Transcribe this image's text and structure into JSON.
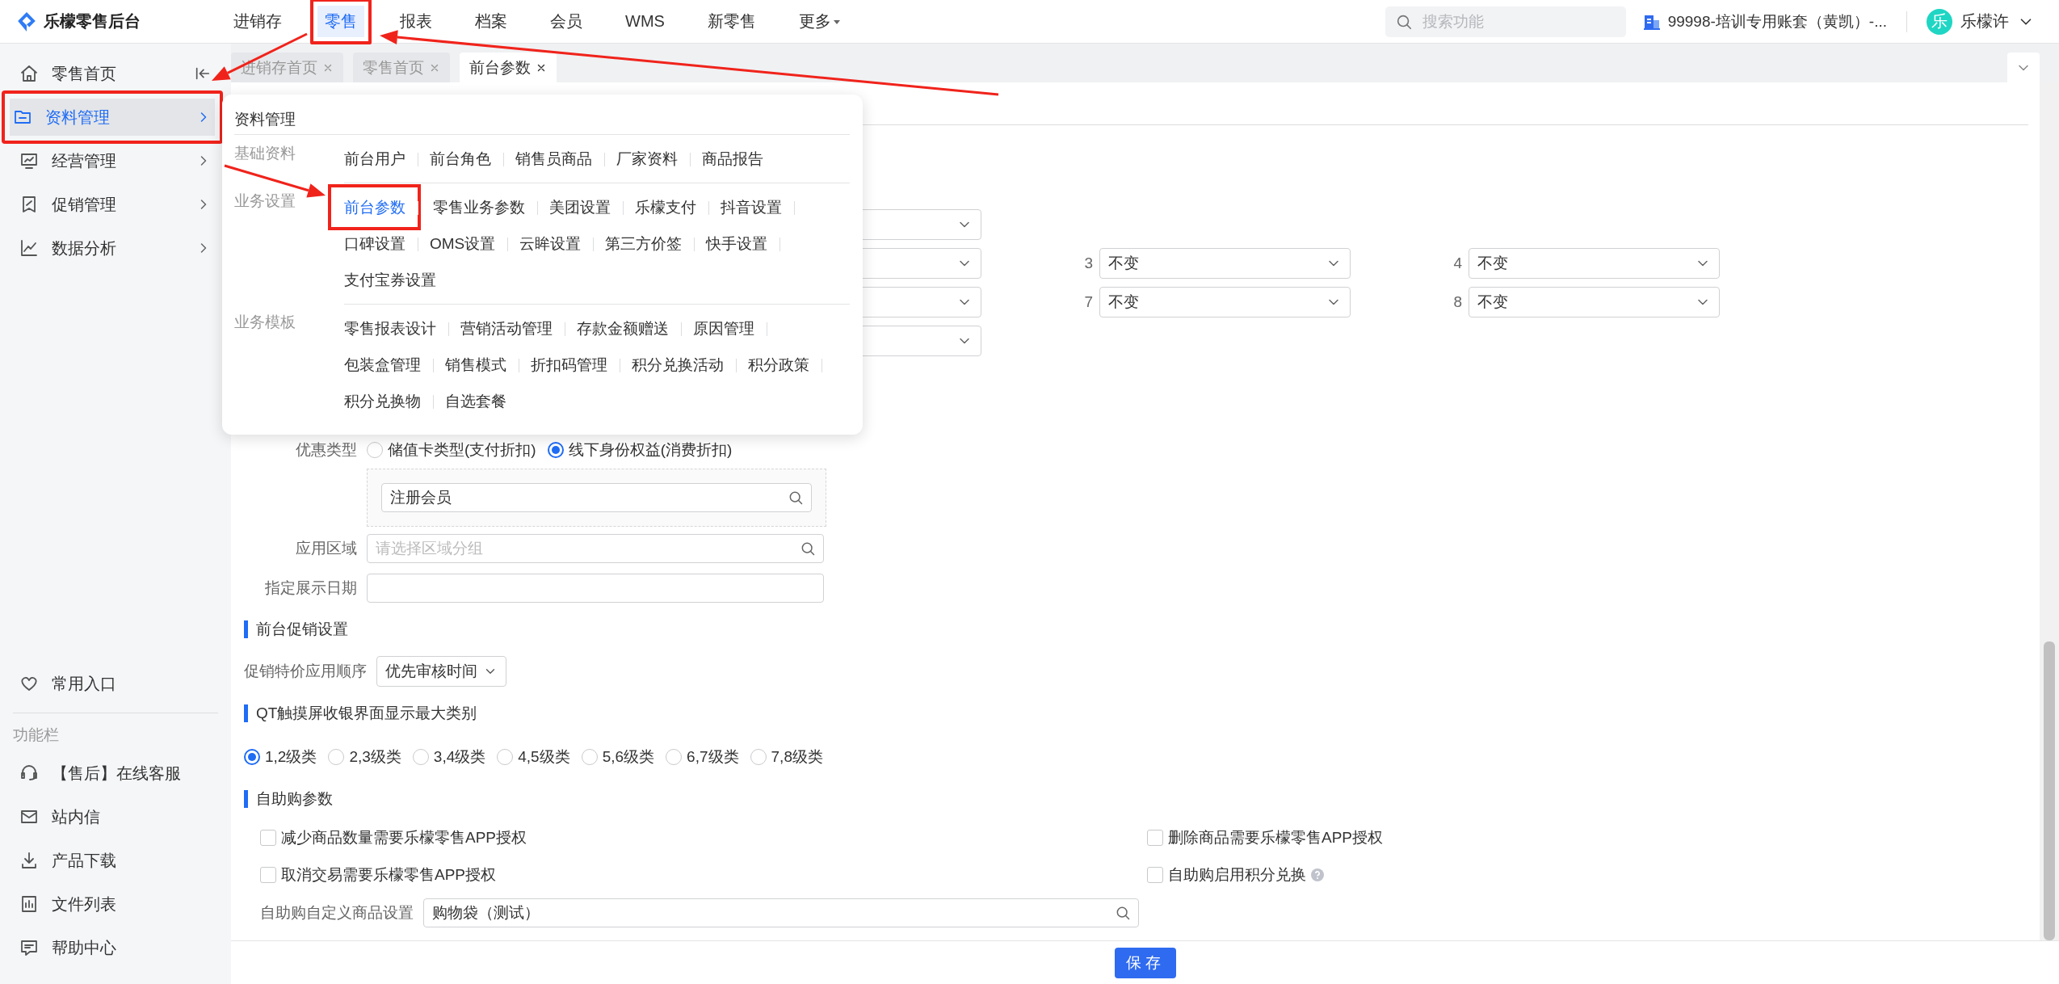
{
  "app": {
    "title": "乐檬零售后台"
  },
  "top_nav": [
    {
      "label": "进销存",
      "selected": false,
      "highlighted": false,
      "dropdown": false
    },
    {
      "label": "零售",
      "selected": true,
      "highlighted": true,
      "dropdown": false
    },
    {
      "label": "报表",
      "selected": false,
      "highlighted": false,
      "dropdown": false
    },
    {
      "label": "档案",
      "selected": false,
      "highlighted": false,
      "dropdown": false
    },
    {
      "label": "会员",
      "selected": false,
      "highlighted": false,
      "dropdown": false
    },
    {
      "label": "WMS",
      "selected": false,
      "highlighted": false,
      "dropdown": false
    },
    {
      "label": "新零售",
      "selected": false,
      "highlighted": false,
      "dropdown": false
    },
    {
      "label": "更多",
      "selected": false,
      "highlighted": false,
      "dropdown": true
    }
  ],
  "search": {
    "placeholder": "搜索功能"
  },
  "account": {
    "name": "99998-培训专用账套（黄凯）-..."
  },
  "user": {
    "avatar": "乐",
    "name": "乐檬许"
  },
  "sidebar": {
    "collapsible": true,
    "items": [
      {
        "label": "零售首页",
        "kind": "link",
        "selected": false,
        "highlighted": false
      },
      {
        "label": "资料管理",
        "kind": "group",
        "selected": true,
        "highlighted": true
      },
      {
        "label": "经营管理",
        "kind": "group",
        "selected": false,
        "highlighted": false
      },
      {
        "label": "促销管理",
        "kind": "group",
        "selected": false,
        "highlighted": false
      },
      {
        "label": "数据分析",
        "kind": "group",
        "selected": false,
        "highlighted": false
      }
    ],
    "favorites": "常用入口",
    "tools_title": "功能栏",
    "tools": [
      "【售后】在线客服",
      "站内信",
      "产品下载",
      "文件列表",
      "帮助中心"
    ]
  },
  "tabs": [
    {
      "label": "进销存首页",
      "selected": false
    },
    {
      "label": "零售首页",
      "selected": false
    },
    {
      "label": "前台参数",
      "selected": true
    }
  ],
  "menu": {
    "title": "资料管理",
    "groups": [
      {
        "label": "基础资料",
        "items": [
          {
            "label": "前台用户",
            "selected": false,
            "highlighted": false
          },
          {
            "label": "前台角色",
            "selected": false,
            "highlighted": false
          },
          {
            "label": "销售员商品",
            "selected": false,
            "highlighted": false
          },
          {
            "label": "厂家资料",
            "selected": false,
            "highlighted": false
          },
          {
            "label": "商品报告",
            "selected": false,
            "highlighted": false
          }
        ]
      },
      {
        "label": "业务设置",
        "items": [
          {
            "label": "前台参数",
            "selected": true,
            "highlighted": true
          },
          {
            "label": "零售业务参数",
            "selected": false,
            "highlighted": false
          },
          {
            "label": "美团设置",
            "selected": false,
            "highlighted": false
          },
          {
            "label": "乐檬支付",
            "selected": false,
            "highlighted": false
          },
          {
            "label": "抖音设置",
            "selected": false,
            "highlighted": false
          },
          {
            "label": "口碑设置",
            "selected": false,
            "highlighted": false
          },
          {
            "label": "OMS设置",
            "selected": false,
            "highlighted": false
          },
          {
            "label": "云眸设置",
            "selected": false,
            "highlighted": false
          },
          {
            "label": "第三方价签",
            "selected": false,
            "highlighted": false
          },
          {
            "label": "快手设置",
            "selected": false,
            "highlighted": false
          },
          {
            "label": "支付宝券设置",
            "selected": false,
            "highlighted": false
          }
        ]
      },
      {
        "label": "业务模板",
        "items": [
          {
            "label": "零售报表设计",
            "selected": false,
            "highlighted": false
          },
          {
            "label": "营销活动管理",
            "selected": false,
            "highlighted": false
          },
          {
            "label": "存款金额赠送",
            "selected": false,
            "highlighted": false
          },
          {
            "label": "原因管理",
            "selected": false,
            "highlighted": false
          },
          {
            "label": "包装盒管理",
            "selected": false,
            "highlighted": false
          },
          {
            "label": "销售模式",
            "selected": false,
            "highlighted": false
          },
          {
            "label": "折扣码管理",
            "selected": false,
            "highlighted": false
          },
          {
            "label": "积分兑换活动",
            "selected": false,
            "highlighted": false
          },
          {
            "label": "积分政策",
            "selected": false,
            "highlighted": false
          },
          {
            "label": "积分兑换物",
            "selected": false,
            "highlighted": false
          },
          {
            "label": "自选套餐",
            "selected": false,
            "highlighted": false
          }
        ]
      }
    ]
  },
  "grade_rows": [
    [
      {}
    ],
    [
      {},
      {
        "label": "3",
        "value": "不变"
      },
      {
        "label": "4",
        "value": "不变"
      }
    ],
    [
      {},
      {
        "label": "7",
        "value": "不变"
      },
      {
        "label": "8",
        "value": "不变"
      }
    ],
    [
      {}
    ]
  ],
  "discount_type": {
    "label": "优惠类型",
    "options": [
      {
        "label": "储值卡类型(支付折扣)",
        "selected": false
      },
      {
        "label": "线下身份权益(消费折扣)",
        "selected": true
      }
    ]
  },
  "member_field": {
    "value": "注册会员"
  },
  "region": {
    "label": "应用区域",
    "placeholder": "请选择区域分组"
  },
  "display_date": {
    "label": "指定展示日期"
  },
  "promo_section": {
    "title": "前台促销设置",
    "order": {
      "label": "促销特价应用顺序",
      "value": "优先审核时间"
    }
  },
  "qt_section": {
    "title": "QT触摸屏收银界面显示最大类别",
    "options": [
      {
        "label": "1,2级类",
        "selected": true
      },
      {
        "label": "2,3级类",
        "selected": false
      },
      {
        "label": "3,4级类",
        "selected": false
      },
      {
        "label": "4,5级类",
        "selected": false
      },
      {
        "label": "5,6级类",
        "selected": false
      },
      {
        "label": "6,7级类",
        "selected": false
      },
      {
        "label": "7,8级类",
        "selected": false
      }
    ]
  },
  "self_service": {
    "title": "自助购参数",
    "checkboxes": [
      {
        "label": "减少商品数量需要乐檬零售APP授权",
        "checked": false,
        "help": false
      },
      {
        "label": "删除商品需要乐檬零售APP授权",
        "checked": false,
        "help": false
      },
      {
        "label": "取消交易需要乐檬零售APP授权",
        "checked": false,
        "help": false
      },
      {
        "label": "自助购启用积分兑换",
        "checked": false,
        "help": true
      }
    ],
    "custom_goods": {
      "label": "自助购自定义商品设置",
      "value": "购物袋（测试）"
    }
  },
  "save_button": "保存"
}
